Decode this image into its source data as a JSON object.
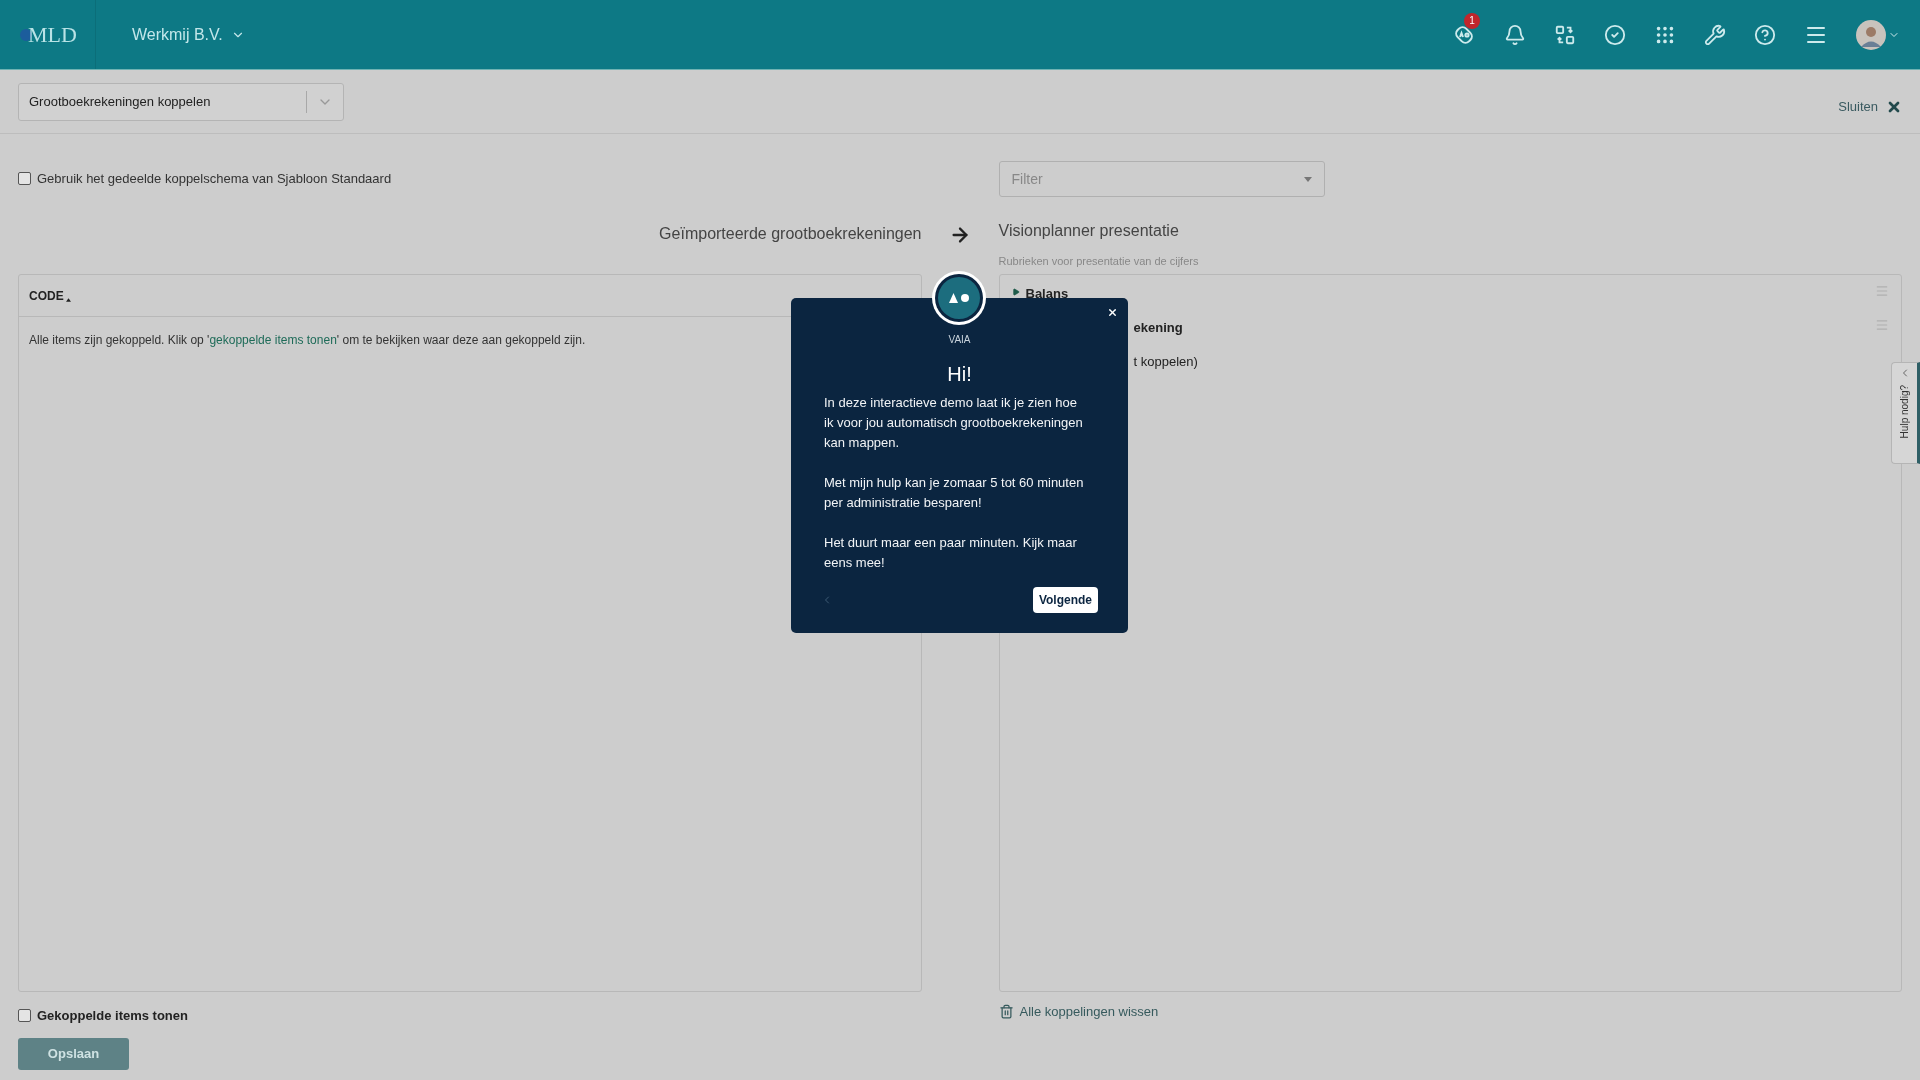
{
  "top_bar": {
    "logo": "MLD",
    "company": "Werkmij B.V.",
    "notification_badge": "1"
  },
  "module_select": {
    "value": "Grootboekrekeningen koppelen"
  },
  "close_link": "Sluiten",
  "shared_schema_checkbox": {
    "label": "Gebruik het gedeelde koppelschema van Sjabloon Standaard",
    "checked": false
  },
  "filter": {
    "placeholder": "Filter"
  },
  "left_column": {
    "title": "Geïmporteerde grootboekrekeningen",
    "table_header": "CODE",
    "message_before": "Alle items zijn gekoppeld. Klik op '",
    "message_link": "gekoppelde items tonen",
    "message_after": "' om te bekijken waar deze aan gekoppeld zijn."
  },
  "right_column": {
    "title": "Visionplanner presentatie",
    "subtitle": "Rubrieken voor presentatie van de cijfers",
    "items": [
      {
        "label": "Balans",
        "kind": "group",
        "expanded": false
      },
      {
        "label": "ekening",
        "kind": "partial-group"
      },
      {
        "label": "t koppelen)",
        "kind": "partial-text"
      }
    ]
  },
  "show_linked_checkbox": {
    "label": "Gekoppelde items tonen",
    "checked": false
  },
  "save_button": "Opslaan",
  "clear_link": "Alle koppelingen wissen",
  "help_tab": "Hulp nodig?",
  "dialog": {
    "assistant": "VAIA",
    "title": "Hi!",
    "paragraphs": [
      "In deze interactieve demo laat ik je zien hoe ik voor jou automatisch grootboekrekeningen kan mappen.",
      "Met mijn hulp kan je zomaar 5 tot 60 minuten per administratie besparen!",
      "Het duurt maar een paar minuten. Kijk maar eens mee!"
    ],
    "next_button": "Volgende"
  }
}
